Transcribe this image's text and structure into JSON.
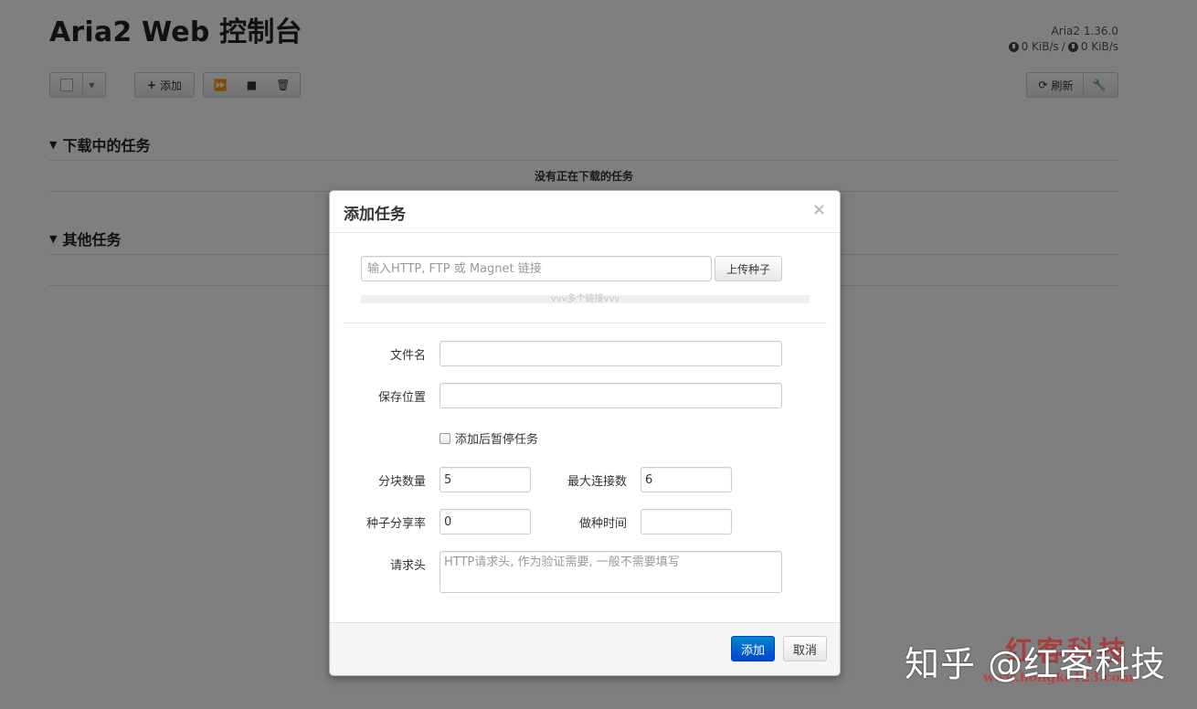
{
  "app": {
    "title": "Aria2 Web 控制台",
    "version": "Aria2 1.36.0",
    "download_speed": "0 KiB/s",
    "speed_separator": "/",
    "upload_speed": "0 KiB/s"
  },
  "toolbar": {
    "add_label": "添加",
    "refresh_label": "刷新"
  },
  "sections": {
    "downloading_title": "下载中的任务",
    "downloading_empty": "没有正在下载的任务",
    "other_title": "其他任务"
  },
  "modal": {
    "title": "添加任务",
    "close_glyph": "×",
    "url_placeholder": "输入HTTP, FTP 或 Magnet 链接",
    "upload_torrent_label": "上传种子",
    "multi_link_label": "vvv多个链接vvv",
    "fields": {
      "filename_label": "文件名",
      "filename_value": "",
      "save_path_label": "保存位置",
      "save_path_value": "",
      "pause_after_add_label": "添加后暂停任务",
      "split_label": "分块数量",
      "split_value": "5",
      "max_conn_label": "最大连接数",
      "max_conn_value": "6",
      "seed_ratio_label": "种子分享率",
      "seed_ratio_value": "0",
      "seed_time_label": "做种时间",
      "seed_time_value": "",
      "header_label": "请求头",
      "header_placeholder": "HTTP请求头, 作为验证需要, 一般不需要填写"
    },
    "submit_label": "添加",
    "cancel_label": "取消"
  },
  "watermark": {
    "zhihu": "知乎 @红客科技",
    "brand": "红客科技",
    "url": "www.hongke123.com"
  },
  "colors": {
    "primary": "#0066cc",
    "backdrop": "#000000"
  }
}
